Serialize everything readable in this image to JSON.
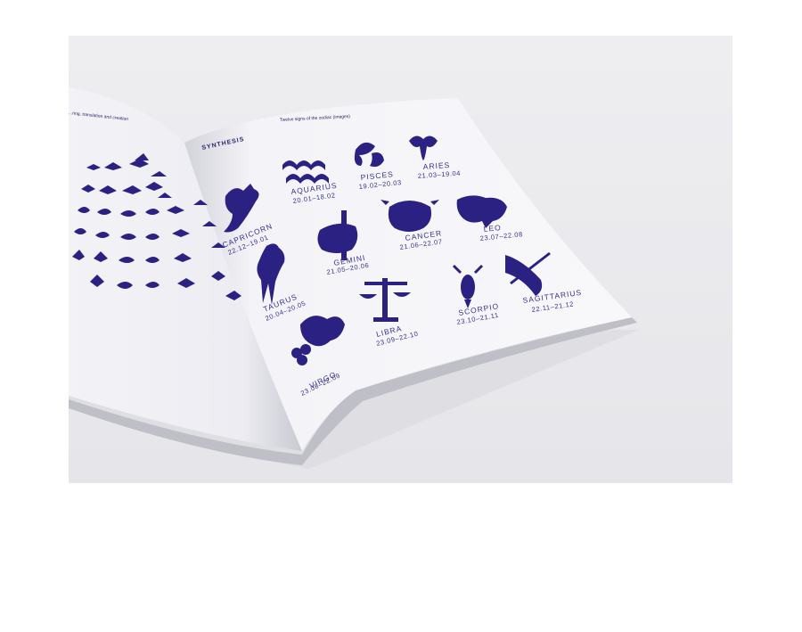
{
  "book": {
    "left_header": "...ring, translation and creation",
    "right_header": "Twelve signs of the zodiac (images)",
    "section_title": "SYNTHESIS"
  },
  "signs": [
    {
      "name": "AQUARIUS",
      "dates": "20.01–18.02"
    },
    {
      "name": "PISCES",
      "dates": "19.02–20.03"
    },
    {
      "name": "ARIES",
      "dates": "21.03–19.04"
    },
    {
      "name": "CAPRICORN",
      "dates": "22.12–19.01"
    },
    {
      "name": "GEMINI",
      "dates": "21.05–20.06"
    },
    {
      "name": "CANCER",
      "dates": "21.06–22.07"
    },
    {
      "name": "LEO",
      "dates": "23.07–22.08"
    },
    {
      "name": "TAURUS",
      "dates": "20.04–20.05"
    },
    {
      "name": "LIBRA",
      "dates": "23.09–22.10"
    },
    {
      "name": "SCORPIO",
      "dates": "23.10–21.11"
    },
    {
      "name": "SAGITTARIUS",
      "dates": "22.11–21.12"
    },
    {
      "name": "VIRGO",
      "dates": "23.08–22.09"
    }
  ],
  "colors": {
    "ink": "#2a2183",
    "paper": "#f6f6f9",
    "background": "#ececef"
  }
}
